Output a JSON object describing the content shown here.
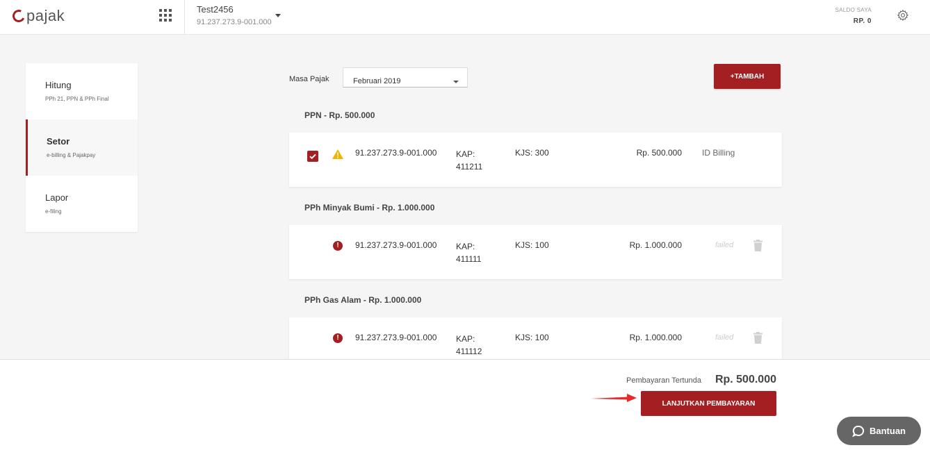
{
  "header": {
    "logo_text": "pajak",
    "account_name": "Test2456",
    "account_npwp": "91.237.273.9-001.000",
    "saldo_label": "SALDO SAYA",
    "saldo_value": "RP. 0"
  },
  "sidebar": {
    "items": [
      {
        "title": "Hitung",
        "subtitle": "PPh 21, PPN & PPh Final"
      },
      {
        "title": "Setor",
        "subtitle": "e-billing & Pajakpay"
      },
      {
        "title": "Lapor",
        "subtitle": "e-filing"
      }
    ]
  },
  "main": {
    "masa_label": "Masa Pajak",
    "masa_value": "Februari 2019",
    "tambah_label": "+TAMBAH",
    "sections": [
      {
        "title": "PPN - Rp. 500.000",
        "row": {
          "npwp": "91.237.273.9-001.000",
          "kap_label": "KAP:",
          "kap": "411211",
          "kjs": "KJS: 300",
          "amount": "Rp. 500.000",
          "status": "ID Billing"
        }
      },
      {
        "title": "PPh Minyak Bumi - Rp. 1.000.000",
        "row": {
          "npwp": "91.237.273.9-001.000",
          "kap_label": "KAP:",
          "kap": "411111",
          "kjs": "KJS: 100",
          "amount": "Rp. 1.000.000",
          "status": "failed"
        }
      },
      {
        "title": "PPh Gas Alam - Rp. 1.000.000",
        "row": {
          "npwp": "91.237.273.9-001.000",
          "kap_label": "KAP:",
          "kap": "411112",
          "kjs": "KJS: 100",
          "amount": "Rp. 1.000.000",
          "status": "failed"
        }
      }
    ]
  },
  "footer": {
    "pending_label": "Pembayaran Tertunda",
    "pending_value": "Rp. 500.000",
    "continue_label": "LANJUTKAN PEMBAYARAN",
    "help_label": "Bantuan"
  },
  "colors": {
    "accent": "#a31f22",
    "warning": "#f0b400",
    "help_button": "#666666"
  },
  "icons": [
    "apps-grid-icon",
    "chevron-down-icon",
    "gear-icon",
    "checkbox-checked-icon",
    "warning-icon",
    "error-icon",
    "trash-icon",
    "arrow-right-icon",
    "chat-icon"
  ]
}
